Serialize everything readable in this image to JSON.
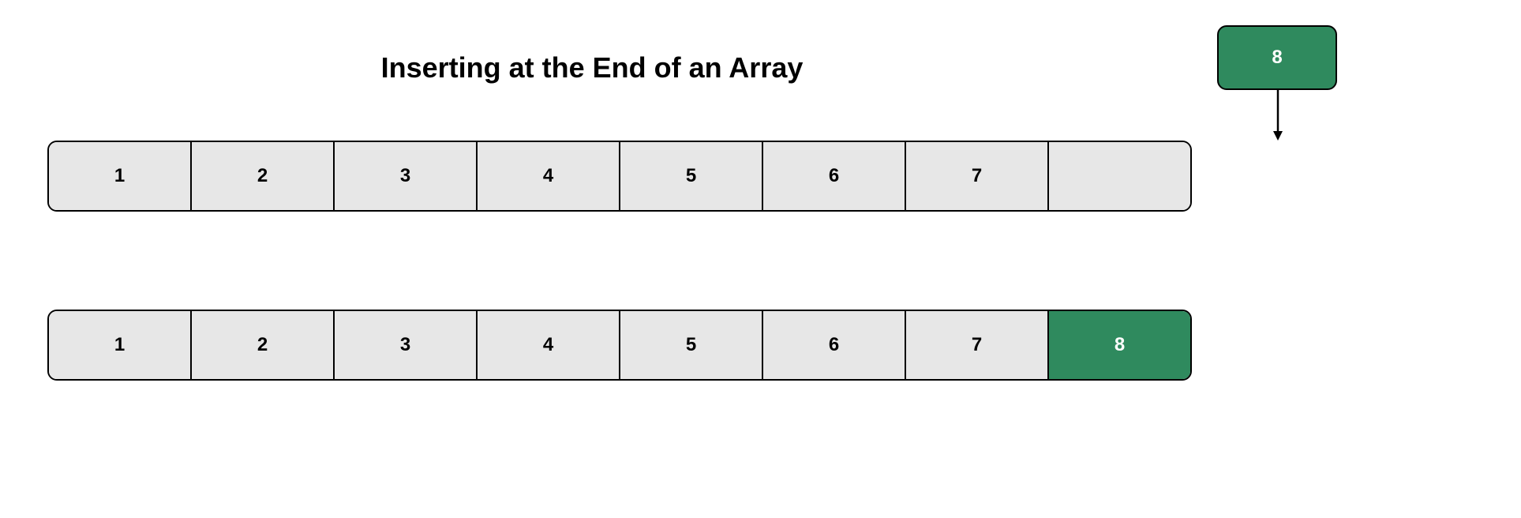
{
  "title": "Inserting at the End of an Array",
  "insert_value": "8",
  "row1": {
    "cells": [
      "1",
      "2",
      "3",
      "4",
      "5",
      "6",
      "7",
      ""
    ]
  },
  "row2": {
    "cells": [
      "1",
      "2",
      "3",
      "4",
      "5",
      "6",
      "7",
      "8"
    ],
    "highlight_index": 7
  },
  "colors": {
    "cell_bg": "#e7e7e7",
    "highlight_bg": "#2f8a5e",
    "border": "#000000"
  }
}
